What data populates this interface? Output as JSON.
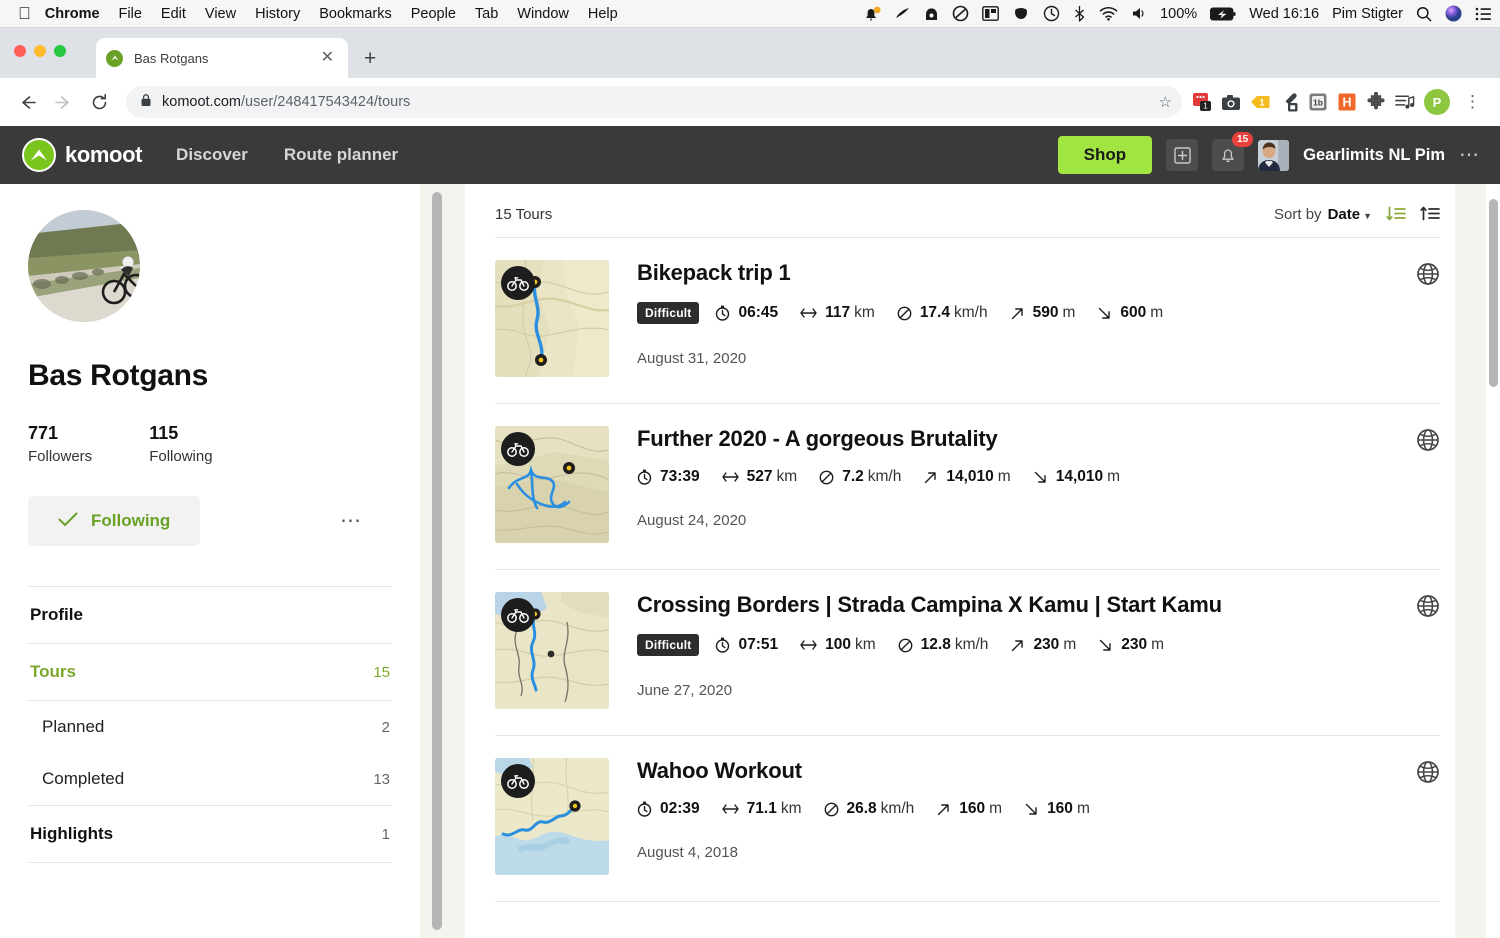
{
  "os_menubar": {
    "apple_icon": "apple-logo",
    "items": [
      "Chrome",
      "File",
      "Edit",
      "View",
      "History",
      "Bookmarks",
      "People",
      "Tab",
      "Window",
      "Help"
    ],
    "status_icons": [
      "notification-bell-icon",
      "pen-icon",
      "backup-icon",
      "circle-slash-icon",
      "screen-layout-icon",
      "coffee-icon",
      "time-machine-icon",
      "bluetooth-icon",
      "wifi-icon",
      "volume-icon"
    ],
    "battery": "100%",
    "battery_icon": "battery-charging-icon",
    "datetime": "Wed 16:16",
    "user": "Pim Stigter",
    "search_icon": "spotlight-search-icon",
    "siri_icon": "siri-icon",
    "controlcenter_icon": "control-center-icon"
  },
  "browser": {
    "tab": {
      "title": "Bas Rotgans",
      "favicon": "komoot-favicon",
      "close_icon": "close-icon"
    },
    "new_tab_label": "+",
    "back_icon": "back-arrow-icon",
    "forward_icon": "forward-arrow-icon",
    "reload_icon": "reload-icon",
    "lock_icon": "lock-icon",
    "url_domain": "komoot.com",
    "url_path": "/user/248417543424/tours",
    "url_full": "komoot.com/user/248417543424/tours",
    "bookmark_icon": "star-icon",
    "extensions": [
      "red-badge-extension-icon",
      "camera-extension-icon",
      "yellow-tag-extension-icon",
      "eyedropper-extension-icon",
      "1b-extension-icon",
      "h-extension-icon",
      "puzzle-extensions-icon",
      "playlist-icon"
    ],
    "profile_initial": "P",
    "menu_icon": "chrome-menu-icon"
  },
  "komoot_nav": {
    "logo_text": "komoot",
    "links": [
      "Discover",
      "Route planner"
    ],
    "shop_label": "Shop",
    "plus_icon": "plus-square-icon",
    "bell_icon": "bell-icon",
    "notification_count": "15",
    "user_name": "Gearlimits NL Pim",
    "more_icon": "more-dots-icon",
    "accent_green": "#a0e541",
    "bar_bg": "#3a3a3a"
  },
  "sidebar": {
    "avatar": "profile-avatar",
    "name": "Bas Rotgans",
    "stats": [
      {
        "num": "771",
        "label": "Followers"
      },
      {
        "num": "115",
        "label": "Following"
      }
    ],
    "follow_button": {
      "label": "Following",
      "icon": "check-icon"
    },
    "more_icon": "more-dots-icon",
    "nav": [
      {
        "label": "Profile",
        "count": "",
        "active": false,
        "sub": false
      },
      {
        "label": "Tours",
        "count": "15",
        "active": true,
        "sub": false
      },
      {
        "label": "Planned",
        "count": "2",
        "active": false,
        "sub": true
      },
      {
        "label": "Completed",
        "count": "13",
        "active": false,
        "sub": true
      },
      {
        "label": "Highlights",
        "count": "1",
        "active": false,
        "sub": false
      }
    ],
    "green": "#7ba82c"
  },
  "main": {
    "count_label": "15 Tours",
    "sort_prefix": "Sort by",
    "sort_value": "Date",
    "sort_desc_icon": "sort-descending-icon",
    "sort_asc_icon": "sort-ascending-icon",
    "tours": [
      {
        "title": "Bikepack trip 1",
        "difficulty": "Difficult",
        "duration": "06:45",
        "distance_value": "117",
        "distance_unit": "km",
        "speed_value": "17.4",
        "speed_unit": "km/h",
        "up_value": "590",
        "up_unit": "m",
        "down_value": "600",
        "down_unit": "m",
        "date": "August 31, 2020",
        "visibility_icon": "globe-icon",
        "sport_icon": "bicycle-icon",
        "map_style": "river-valley"
      },
      {
        "title": "Further 2020 - A gorgeous Brutality",
        "difficulty": "",
        "duration": "73:39",
        "distance_value": "527",
        "distance_unit": "km",
        "speed_value": "7.2",
        "speed_unit": "km/h",
        "up_value": "14,010",
        "up_unit": "m",
        "down_value": "14,010",
        "down_unit": "m",
        "date": "August 24, 2020",
        "visibility_icon": "globe-icon",
        "sport_icon": "bicycle-icon",
        "map_style": "mountain-loop"
      },
      {
        "title": "Crossing Borders | Strada Campina X Kamu | Start Kamu",
        "difficulty": "Difficult",
        "duration": "07:51",
        "distance_value": "100",
        "distance_unit": "km",
        "speed_value": "12.8",
        "speed_unit": "km/h",
        "up_value": "230",
        "up_unit": "m",
        "down_value": "230",
        "down_unit": "m",
        "date": "June 27, 2020",
        "visibility_icon": "globe-icon",
        "sport_icon": "bicycle-icon",
        "map_style": "border-route"
      },
      {
        "title": "Wahoo Workout",
        "difficulty": "",
        "duration": "02:39",
        "distance_value": "71.1",
        "distance_unit": "km",
        "speed_value": "26.8",
        "speed_unit": "km/h",
        "up_value": "160",
        "up_unit": "m",
        "down_value": "160",
        "down_unit": "m",
        "date": "August 4, 2018",
        "visibility_icon": "globe-icon",
        "sport_icon": "bicycle-icon",
        "map_style": "coastal"
      }
    ],
    "stat_icons": {
      "duration": "stopwatch-icon",
      "distance": "left-right-arrow-icon",
      "speed": "speed-gauge-icon",
      "up": "arrow-up-right-icon",
      "down": "arrow-down-right-icon"
    }
  }
}
